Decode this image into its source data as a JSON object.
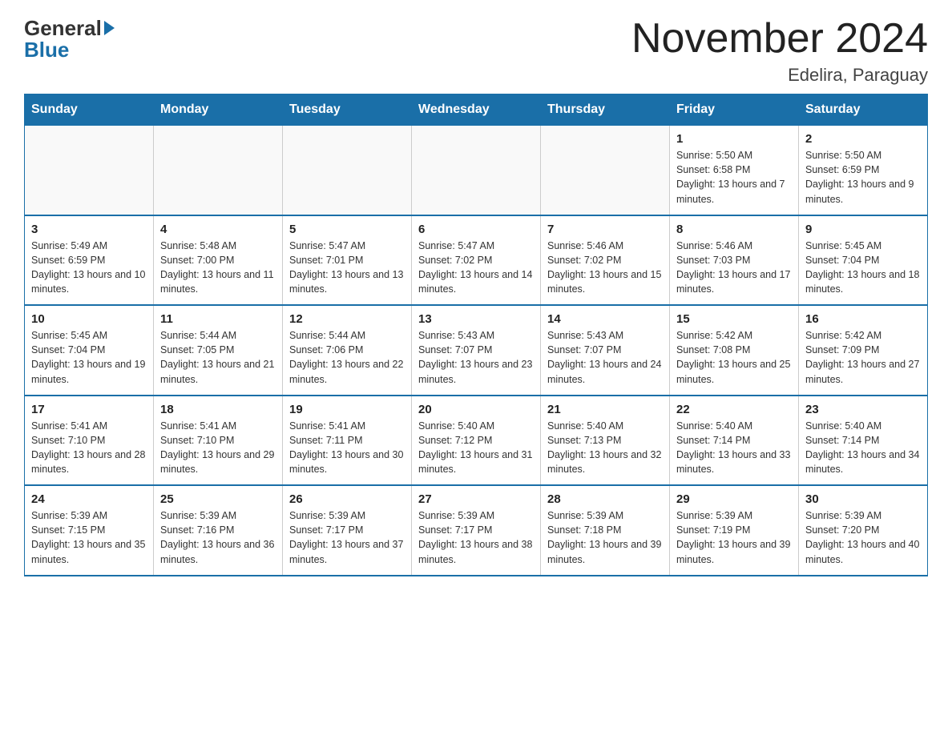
{
  "header": {
    "logo_general": "General",
    "logo_blue": "Blue",
    "month_title": "November 2024",
    "location": "Edelira, Paraguay"
  },
  "weekdays": [
    "Sunday",
    "Monday",
    "Tuesday",
    "Wednesday",
    "Thursday",
    "Friday",
    "Saturday"
  ],
  "weeks": [
    [
      {
        "day": "",
        "info": ""
      },
      {
        "day": "",
        "info": ""
      },
      {
        "day": "",
        "info": ""
      },
      {
        "day": "",
        "info": ""
      },
      {
        "day": "",
        "info": ""
      },
      {
        "day": "1",
        "info": "Sunrise: 5:50 AM\nSunset: 6:58 PM\nDaylight: 13 hours and 7 minutes."
      },
      {
        "day": "2",
        "info": "Sunrise: 5:50 AM\nSunset: 6:59 PM\nDaylight: 13 hours and 9 minutes."
      }
    ],
    [
      {
        "day": "3",
        "info": "Sunrise: 5:49 AM\nSunset: 6:59 PM\nDaylight: 13 hours and 10 minutes."
      },
      {
        "day": "4",
        "info": "Sunrise: 5:48 AM\nSunset: 7:00 PM\nDaylight: 13 hours and 11 minutes."
      },
      {
        "day": "5",
        "info": "Sunrise: 5:47 AM\nSunset: 7:01 PM\nDaylight: 13 hours and 13 minutes."
      },
      {
        "day": "6",
        "info": "Sunrise: 5:47 AM\nSunset: 7:02 PM\nDaylight: 13 hours and 14 minutes."
      },
      {
        "day": "7",
        "info": "Sunrise: 5:46 AM\nSunset: 7:02 PM\nDaylight: 13 hours and 15 minutes."
      },
      {
        "day": "8",
        "info": "Sunrise: 5:46 AM\nSunset: 7:03 PM\nDaylight: 13 hours and 17 minutes."
      },
      {
        "day": "9",
        "info": "Sunrise: 5:45 AM\nSunset: 7:04 PM\nDaylight: 13 hours and 18 minutes."
      }
    ],
    [
      {
        "day": "10",
        "info": "Sunrise: 5:45 AM\nSunset: 7:04 PM\nDaylight: 13 hours and 19 minutes."
      },
      {
        "day": "11",
        "info": "Sunrise: 5:44 AM\nSunset: 7:05 PM\nDaylight: 13 hours and 21 minutes."
      },
      {
        "day": "12",
        "info": "Sunrise: 5:44 AM\nSunset: 7:06 PM\nDaylight: 13 hours and 22 minutes."
      },
      {
        "day": "13",
        "info": "Sunrise: 5:43 AM\nSunset: 7:07 PM\nDaylight: 13 hours and 23 minutes."
      },
      {
        "day": "14",
        "info": "Sunrise: 5:43 AM\nSunset: 7:07 PM\nDaylight: 13 hours and 24 minutes."
      },
      {
        "day": "15",
        "info": "Sunrise: 5:42 AM\nSunset: 7:08 PM\nDaylight: 13 hours and 25 minutes."
      },
      {
        "day": "16",
        "info": "Sunrise: 5:42 AM\nSunset: 7:09 PM\nDaylight: 13 hours and 27 minutes."
      }
    ],
    [
      {
        "day": "17",
        "info": "Sunrise: 5:41 AM\nSunset: 7:10 PM\nDaylight: 13 hours and 28 minutes."
      },
      {
        "day": "18",
        "info": "Sunrise: 5:41 AM\nSunset: 7:10 PM\nDaylight: 13 hours and 29 minutes."
      },
      {
        "day": "19",
        "info": "Sunrise: 5:41 AM\nSunset: 7:11 PM\nDaylight: 13 hours and 30 minutes."
      },
      {
        "day": "20",
        "info": "Sunrise: 5:40 AM\nSunset: 7:12 PM\nDaylight: 13 hours and 31 minutes."
      },
      {
        "day": "21",
        "info": "Sunrise: 5:40 AM\nSunset: 7:13 PM\nDaylight: 13 hours and 32 minutes."
      },
      {
        "day": "22",
        "info": "Sunrise: 5:40 AM\nSunset: 7:14 PM\nDaylight: 13 hours and 33 minutes."
      },
      {
        "day": "23",
        "info": "Sunrise: 5:40 AM\nSunset: 7:14 PM\nDaylight: 13 hours and 34 minutes."
      }
    ],
    [
      {
        "day": "24",
        "info": "Sunrise: 5:39 AM\nSunset: 7:15 PM\nDaylight: 13 hours and 35 minutes."
      },
      {
        "day": "25",
        "info": "Sunrise: 5:39 AM\nSunset: 7:16 PM\nDaylight: 13 hours and 36 minutes."
      },
      {
        "day": "26",
        "info": "Sunrise: 5:39 AM\nSunset: 7:17 PM\nDaylight: 13 hours and 37 minutes."
      },
      {
        "day": "27",
        "info": "Sunrise: 5:39 AM\nSunset: 7:17 PM\nDaylight: 13 hours and 38 minutes."
      },
      {
        "day": "28",
        "info": "Sunrise: 5:39 AM\nSunset: 7:18 PM\nDaylight: 13 hours and 39 minutes."
      },
      {
        "day": "29",
        "info": "Sunrise: 5:39 AM\nSunset: 7:19 PM\nDaylight: 13 hours and 39 minutes."
      },
      {
        "day": "30",
        "info": "Sunrise: 5:39 AM\nSunset: 7:20 PM\nDaylight: 13 hours and 40 minutes."
      }
    ]
  ]
}
